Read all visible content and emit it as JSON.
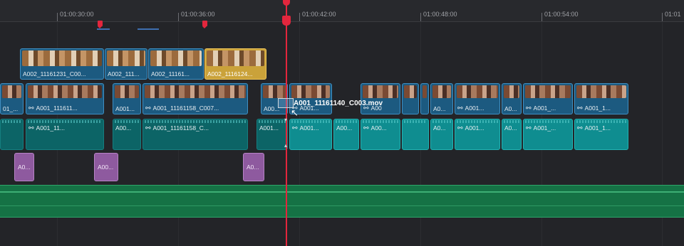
{
  "ruler": {
    "timecodes": [
      "01:00:30:00",
      "01:00:36:00",
      "01:00:42:00",
      "01:00:48:00",
      "01:00:54:00",
      "01:01"
    ]
  },
  "colors": {
    "playhead": "#e3263d",
    "video_clip": "#1c5a80",
    "selected_clip": "#caa23a",
    "audio_clip": "#0f8d90",
    "sfx_clip": "#8e5a9f",
    "music_track": "#157245"
  },
  "video_track_2": {
    "clips": [
      {
        "name": "A002_11161231_C00..."
      },
      {
        "name": "A002_111..."
      },
      {
        "name": "A002_11161..."
      },
      {
        "name": "A002_1116124...",
        "selected": true
      }
    ]
  },
  "video_track_1": {
    "clips": [
      {
        "name": "01_..."
      },
      {
        "name": "A001_111611...",
        "linked": true
      },
      {
        "name": "A001..."
      },
      {
        "name": "A001_11161158_C007...",
        "linked": true
      },
      {
        "name": "A00..."
      },
      {
        "name": "A001...",
        "linked": true
      },
      {
        "name": "A00",
        "linked": true
      },
      {
        "name": ""
      },
      {
        "name": ""
      },
      {
        "name": "A0..."
      },
      {
        "name": "A001...",
        "linked": true
      },
      {
        "name": "A0..."
      },
      {
        "name": "A001_...",
        "linked": true
      },
      {
        "name": "A001_1...",
        "linked": true
      }
    ]
  },
  "audio_track_1": {
    "clips": [
      {
        "name": ""
      },
      {
        "name": "A001_11...",
        "linked": true
      },
      {
        "name": "A00..."
      },
      {
        "name": "A001_11161158_C...",
        "linked": true
      },
      {
        "name": "A001..."
      },
      {
        "name": "A001...",
        "linked": true
      },
      {
        "name": "A00..."
      },
      {
        "name": "A00...",
        "linked": true
      },
      {
        "name": ""
      },
      {
        "name": "A0..."
      },
      {
        "name": "A001...",
        "linked": true
      },
      {
        "name": "A0..."
      },
      {
        "name": "A001_...",
        "linked": true
      },
      {
        "name": "A001_1...",
        "linked": true
      }
    ]
  },
  "sfx_track": {
    "clips": [
      {
        "name": "A0..."
      },
      {
        "name": "A00..."
      },
      {
        "name": "A0..."
      }
    ]
  },
  "drag_overlay": {
    "label": "A001_11161140_C003.mov"
  },
  "icons": {
    "link": "link-icon",
    "playhead": "playhead-icon",
    "marker": "marker-icon",
    "cursor": "move-cursor-icon"
  }
}
